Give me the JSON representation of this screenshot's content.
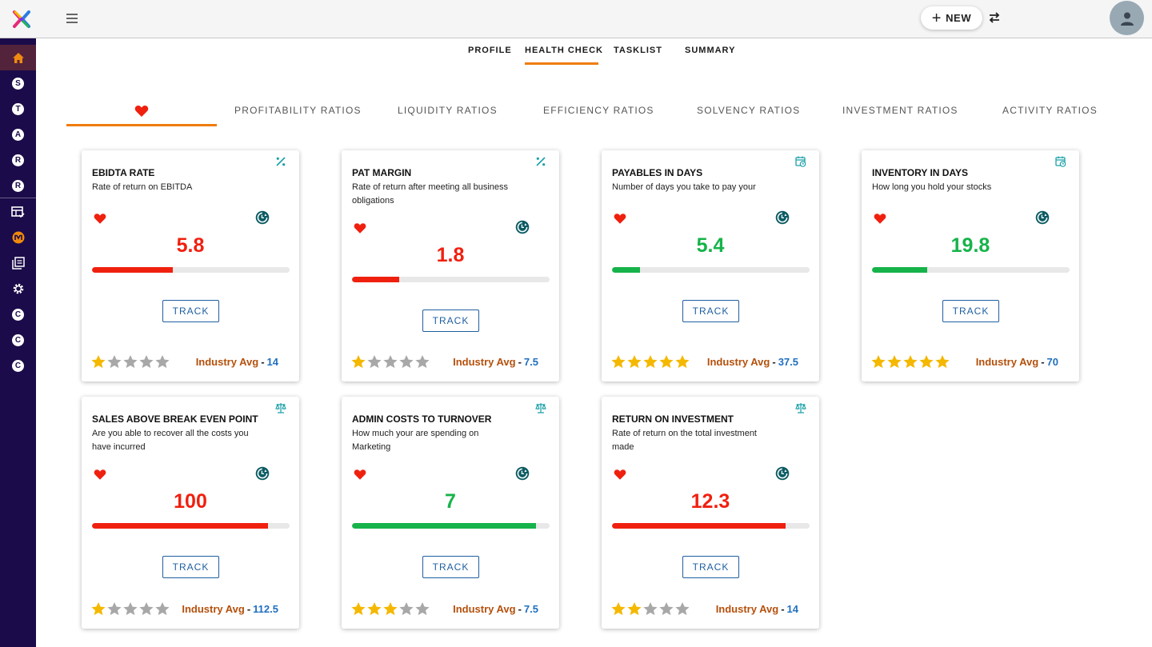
{
  "header": {
    "new_label": "NEW"
  },
  "sidebar": {
    "letters_top": [
      "S",
      "T",
      "A",
      "R",
      "R"
    ],
    "letters_bottom": [
      "C",
      "C",
      "C"
    ]
  },
  "page_tabs": [
    "PROFILE",
    "HEALTH CHECK",
    "TASKLIST",
    "SUMMARY"
  ],
  "active_page_tab": "HEALTH CHECK",
  "ratio_tabs": [
    "PROFITABILITY RATIOS",
    "LIQUIDITY RATIOS",
    "EFFICIENCY RATIOS",
    "SOLVENCY RATIOS",
    "INVESTMENT RATIOS",
    "ACTIVITY RATIOS"
  ],
  "active_ratio_tab": "favorites",
  "colors": {
    "accent": "#ef7d0b",
    "sidebar": "#1b0b4a",
    "bad": "#f0200f",
    "good": "#16b34a",
    "link": "#1f5fa0",
    "star": "#f5b800",
    "star_empty": "#a8a8a8"
  },
  "card_common": {
    "track_label": "TRACK",
    "industry_label": "Industry Avg"
  },
  "cards": [
    {
      "title": "EBIDTA RATE",
      "desc": "Rate of return on EBITDA",
      "type_icon": "percent-icon",
      "value": "5.8",
      "status": "bad",
      "fill": 0.41,
      "stars": 1,
      "industry_avg": "14"
    },
    {
      "title": "PAT MARGIN",
      "desc": "Rate of return after meeting all business obligations",
      "type_icon": "percent-icon",
      "value": "1.8",
      "status": "bad",
      "fill": 0.24,
      "stars": 1,
      "industry_avg": "7.5"
    },
    {
      "title": "PAYABLES IN DAYS",
      "desc": "Number of days you take to pay your",
      "type_icon": "calendar-clock-icon",
      "value": "5.4",
      "status": "good",
      "fill": 0.14,
      "stars": 5,
      "industry_avg": "37.5"
    },
    {
      "title": "INVENTORY IN DAYS",
      "desc": "How long you hold your stocks",
      "type_icon": "calendar-clock-icon",
      "value": "19.8",
      "status": "good",
      "fill": 0.28,
      "stars": 5,
      "industry_avg": "70"
    },
    {
      "title": "SALES ABOVE BREAK EVEN POINT",
      "desc": "Are you able to recover all the costs you have incurred",
      "type_icon": "balance-scale-icon",
      "value": "100",
      "status": "bad",
      "fill": 0.89,
      "stars": 1,
      "industry_avg": "112.5"
    },
    {
      "title": "ADMIN COSTS TO TURNOVER",
      "desc": "How much your are spending on Marketing",
      "type_icon": "balance-scale-icon",
      "value": "7",
      "status": "good",
      "fill": 0.93,
      "stars": 3,
      "industry_avg": "7.5"
    },
    {
      "title": "RETURN ON INVESTMENT",
      "desc": "Rate of return on the total investment made",
      "type_icon": "balance-scale-icon",
      "value": "12.3",
      "status": "bad",
      "fill": 0.88,
      "stars": 2,
      "industry_avg": "14"
    }
  ]
}
